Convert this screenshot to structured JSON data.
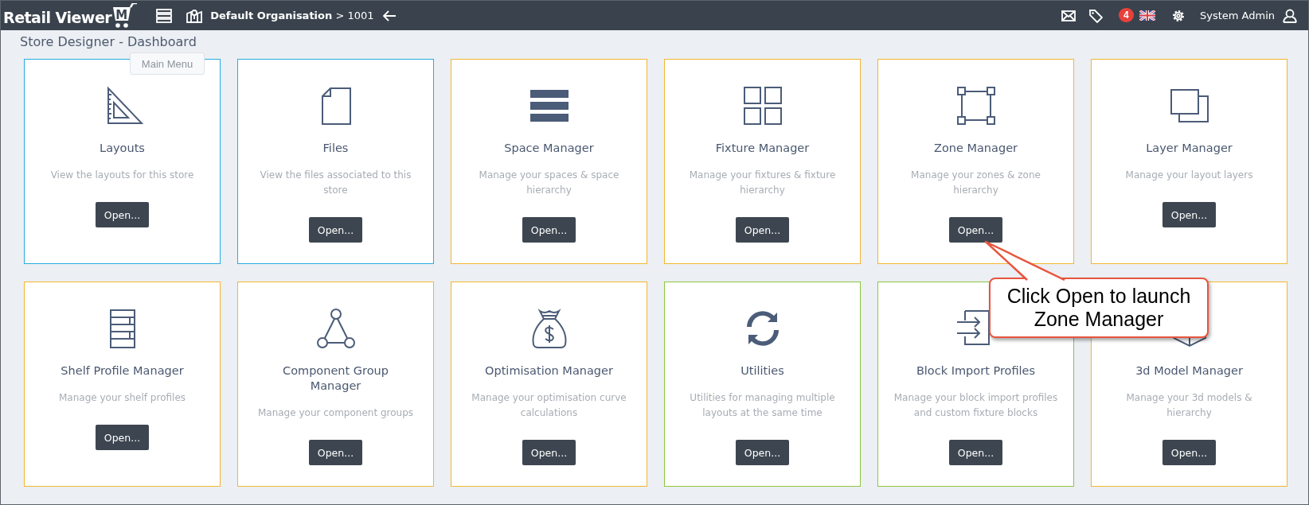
{
  "topbar": {
    "logo": {
      "text": "Retail Viewer",
      "mark": "M"
    },
    "breadcrumb": "**Default Organisation** > 1001",
    "notifications": "4",
    "user": "System Admin"
  },
  "tooltip": "Main Menu",
  "page_title": "Store Designer - Dashboard",
  "cards": [
    {
      "title": "Layouts",
      "description": "View the layouts for this store",
      "button": "Open...",
      "color": "#29abe2"
    },
    {
      "title": "Files",
      "description": "View the files associated to this store",
      "button": "Open...",
      "color": "#29abe2"
    },
    {
      "title": "Space Manager",
      "description": "Manage your spaces & space hierarchy",
      "button": "Open...",
      "color": "#f2b730"
    },
    {
      "title": "Fixture Manager",
      "description": "Manage your fixtures & fixture hierarchy",
      "button": "Open...",
      "color": "#f2b730"
    },
    {
      "title": "Zone Manager",
      "description": "Manage your zones & zone hierarchy",
      "button": "Open...",
      "color": "#f2b730"
    },
    {
      "title": "Layer Manager",
      "description": "Manage your layout layers",
      "button": "Open...",
      "color": "#f2b730"
    },
    {
      "title": "Shelf Profile Manager",
      "description": "Manage your shelf profiles",
      "button": "Open...",
      "color": "#f2b730"
    },
    {
      "title": "Component Group Manager",
      "description": "Manage your component groups",
      "button": "Open...",
      "color": "#f2b730"
    },
    {
      "title": "Optimisation Manager",
      "description": "Manage your optimisation curve calculations",
      "button": "Open...",
      "color": "#f2b730"
    },
    {
      "title": "Utilities",
      "description": "Utilities for managing multiple layouts at the same time",
      "button": "Open...",
      "color": "#8cc63f"
    },
    {
      "title": "Block Import Profiles",
      "description": "Manage your block import profiles and custom fixture blocks",
      "button": "Open...",
      "color": "#8cc63f"
    },
    {
      "title": "3d Model Manager",
      "description": "Manage your 3d models & hierarchy",
      "button": "Open...",
      "color": "#f2b730"
    }
  ],
  "callout": {
    "text": "Click Open to launch Zone Manager"
  }
}
